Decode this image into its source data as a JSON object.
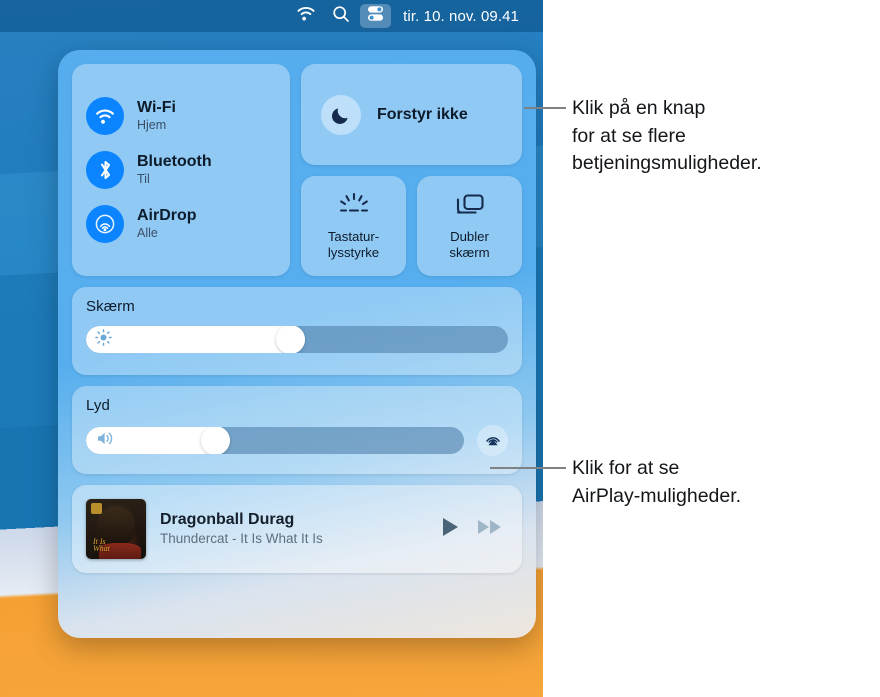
{
  "menubar": {
    "icons": [
      {
        "name": "wifi-icon",
        "label": "Wi-Fi"
      },
      {
        "name": "search-icon",
        "label": "Spotlight"
      },
      {
        "name": "control-center-icon",
        "label": "Kontrolcenter"
      }
    ],
    "clock": "tir. 10. nov.  09.41"
  },
  "control_center": {
    "connectivity": [
      {
        "icon": "wifi-icon",
        "title": "Wi-Fi",
        "status": "Hjem"
      },
      {
        "icon": "bluetooth-icon",
        "title": "Bluetooth",
        "status": "Til"
      },
      {
        "icon": "airdrop-icon",
        "title": "AirDrop",
        "status": "Alle"
      }
    ],
    "do_not_disturb": {
      "icon": "moon-icon",
      "label": "Forstyr ikke"
    },
    "tiles": [
      {
        "icon": "keyboard-brightness-icon",
        "label": "Tastatur-\nlysstyrke"
      },
      {
        "icon": "mirror-screen-icon",
        "label": "Dubler\nskærm"
      }
    ],
    "display": {
      "title": "Skærm",
      "icon": "brightness-icon",
      "value": 52
    },
    "sound": {
      "title": "Lyd",
      "icon": "speaker-icon",
      "value": 38,
      "airplay_icon": "airplay-audio-icon"
    },
    "now_playing": {
      "artwork": "album-artwork",
      "title": "Dragonball Durag",
      "subtitle": "Thundercat - It Is What It Is",
      "controls": [
        {
          "name": "play-button",
          "icon": "play-icon"
        },
        {
          "name": "next-button",
          "icon": "fast-forward-icon"
        }
      ]
    }
  },
  "callouts": [
    {
      "text": "Klik på en knap\nfor at se flere\nbetjeningsmuligheder."
    },
    {
      "text": "Klik for at se\nAirPlay-muligheder."
    }
  ],
  "colors": {
    "accent_blue": "#0a84ff",
    "panel_blue": "#56aeee",
    "menubar": "#094d81",
    "text_dark": "#0e1b2a",
    "text_muted": "#3a5068",
    "leader_line": "#7e8285",
    "wallpaper_orange": "#f5a033"
  }
}
